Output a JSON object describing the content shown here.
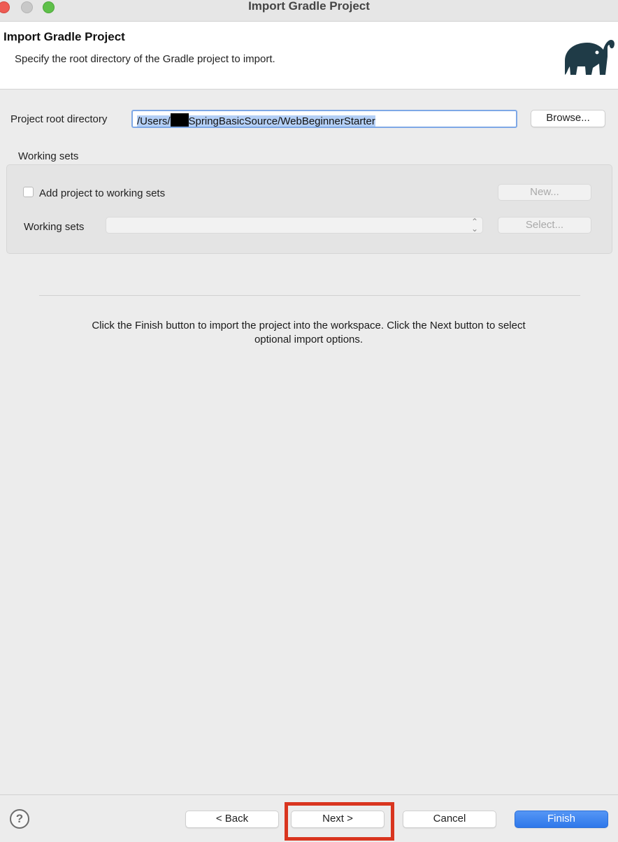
{
  "window": {
    "title": "Import Gradle Project"
  },
  "header": {
    "title": "Import Gradle Project",
    "subtitle": "Specify the root directory of the Gradle project to import.",
    "logo_icon": "gradle-elephant-icon"
  },
  "root": {
    "label": "Project root directory",
    "value_prefix": "/Users/",
    "value_suffix": "SpringBasicSource/WebBeginnerStarter",
    "browse_label": "Browse..."
  },
  "working_sets": {
    "group_title": "Working sets",
    "add_checkbox_label": "Add project to working sets",
    "add_checked": false,
    "new_label": "New...",
    "select_label": "Working sets",
    "select_value": "",
    "select_button_label": "Select..."
  },
  "info_text": "Click the Finish button to import the project into the workspace. Click the Next button to select optional import options.",
  "footer": {
    "help_label": "?",
    "back_label": "< Back",
    "next_label": "Next >",
    "cancel_label": "Cancel",
    "finish_label": "Finish"
  },
  "colors": {
    "accent": "#2f78ea",
    "highlight": "#d9351f",
    "selection": "#b4cff5"
  }
}
